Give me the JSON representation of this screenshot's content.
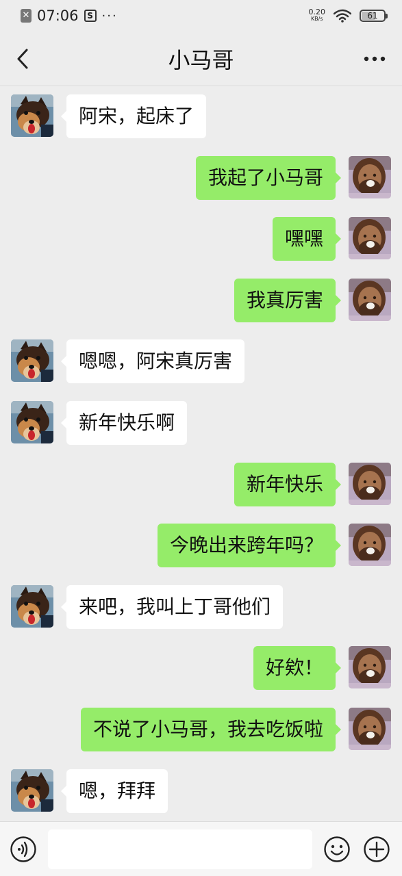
{
  "status_bar": {
    "time": "07:06",
    "net_speed_value": "0.20",
    "net_speed_unit": "KB/s",
    "battery_level": "61"
  },
  "header": {
    "title": "小马哥"
  },
  "messages": [
    {
      "side": "left",
      "text": "阿宋，起床了"
    },
    {
      "side": "right",
      "text": "我起了小马哥"
    },
    {
      "side": "right",
      "text": "嘿嘿"
    },
    {
      "side": "right",
      "text": "我真厉害"
    },
    {
      "side": "left",
      "text": "嗯嗯，阿宋真厉害"
    },
    {
      "side": "left",
      "text": "新年快乐啊"
    },
    {
      "side": "right",
      "text": "新年快乐"
    },
    {
      "side": "right",
      "text": "今晚出来跨年吗？"
    },
    {
      "side": "left",
      "text": "来吧，我叫上丁哥他们"
    },
    {
      "side": "right",
      "text": "好欸！"
    },
    {
      "side": "right",
      "text": "不说了小马哥，我去吃饭啦"
    },
    {
      "side": "left",
      "text": "嗯，拜拜"
    }
  ],
  "input_bar": {
    "text_value": "",
    "icons": [
      "voice-icon",
      "emoji-icon",
      "plus-icon"
    ]
  },
  "colors": {
    "background": "#ededed",
    "sent_bubble": "#95ec69",
    "received_bubble": "#ffffff"
  }
}
